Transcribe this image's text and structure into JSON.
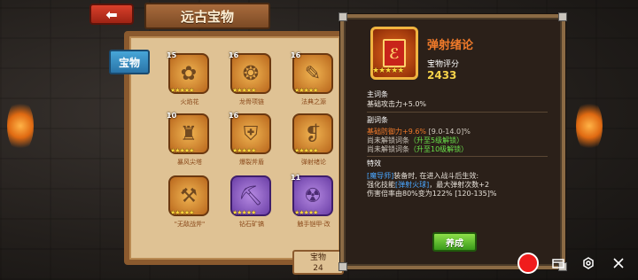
{
  "header": {
    "back_icon": "arrow-left-icon",
    "back_glyph": "⬅",
    "title": "远古宝物"
  },
  "sidebar": {
    "tab_label": "宝物"
  },
  "grid": {
    "items": [
      {
        "level": "15",
        "name": "火焰花",
        "rarity": "gold",
        "icon": "flower-icon"
      },
      {
        "level": "16",
        "name": "龙骨项链",
        "rarity": "gold",
        "icon": "necklace-icon"
      },
      {
        "level": "16",
        "name": "法典之源",
        "rarity": "gold",
        "icon": "scroll-icon"
      },
      {
        "level": "10",
        "name": "暴风尖塔",
        "rarity": "gold",
        "icon": "tower-icon"
      },
      {
        "level": "16",
        "name": "爆裂斧盾",
        "rarity": "gold",
        "icon": "shield-icon"
      },
      {
        "level": "",
        "name": "弹射绪论",
        "rarity": "gold",
        "icon": "book-icon"
      },
      {
        "level": "",
        "name": "\"无敌战斧\"",
        "rarity": "gold",
        "icon": "axe-icon"
      },
      {
        "level": "",
        "name": "钻石矿镐",
        "rarity": "purple",
        "icon": "pickaxe-icon"
      },
      {
        "level": "11",
        "name": "触手铠甲·改",
        "rarity": "purple",
        "icon": "octopus-icon"
      }
    ]
  },
  "score_tab": {
    "label": "宝物",
    "value": "24"
  },
  "detail": {
    "name": "弹射绪论",
    "stars": "★★★★★",
    "score_label": "宝物评分",
    "score": "2433",
    "main_attr_header": "主词条",
    "main_attr": "基础攻击力+5.0%",
    "sub_attr_header": "副词条",
    "sub_attr_value": "基础防御力+9.6%",
    "sub_attr_range": " [9.0-14.0]%",
    "locked_prefix": "尚未解锁词条",
    "locked_1": "（升至5级解锁）",
    "locked_2": "（升至10级解锁）",
    "effect_header": "特效",
    "effect_role": "[魔导师]",
    "effect_line1": "装备时, 在进入战斗后生效:",
    "effect_line2_a": "强化技能",
    "effect_skill": "[弹射火球]",
    "effect_line2_b": "，最大弹射次数+2",
    "effect_line3": "伤害倍率由80%变为122% [120-135]%",
    "train_button": "养成"
  },
  "overlay": {
    "record_icon": "record-icon",
    "gallery_icon": "folder-icon",
    "settings_icon": "settings-icon",
    "close_icon": "close-icon"
  }
}
